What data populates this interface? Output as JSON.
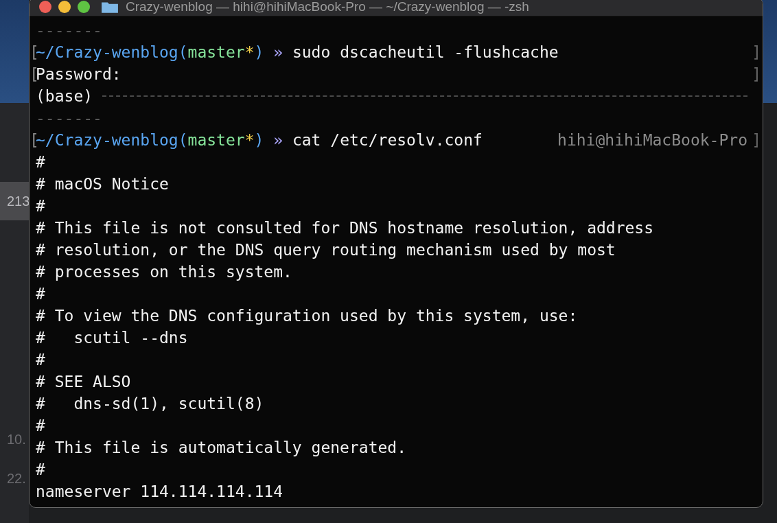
{
  "background": {
    "sizes": [
      {
        "text": "213",
        "selected": true
      },
      {
        "text": "10.",
        "selected": false
      },
      {
        "text": "22.",
        "selected": false
      }
    ]
  },
  "terminal": {
    "title": "Crazy-wenblog — hihi@hihiMacBook-Pro — ~/Crazy-wenblog — -zsh",
    "lines": [
      {
        "kind": "rule_end",
        "text": "-------"
      },
      {
        "kind": "prompt",
        "left_bracket": "[",
        "segments": [
          {
            "text": "~/Crazy-wenblog(",
            "color": "#5aa6f2"
          },
          {
            "text": "master",
            "color": "#86e39a"
          },
          {
            "text": "*",
            "color": "#f3cf4a"
          },
          {
            "text": ")",
            "color": "#5aa6f2"
          },
          {
            "text": " » ",
            "color": "#a9a3f7"
          },
          {
            "text": "sudo dscacheutil -flushcache",
            "color": "#f2f2f2"
          }
        ],
        "right_bracket": "]"
      },
      {
        "kind": "plain",
        "left_bracket": "[",
        "text": "Password:",
        "right_bracket": "]"
      },
      {
        "kind": "base",
        "text": "(base)"
      },
      {
        "kind": "rule_end",
        "text": "-------"
      },
      {
        "kind": "prompt",
        "left_bracket": "[",
        "segments": [
          {
            "text": "~/Crazy-wenblog(",
            "color": "#5aa6f2"
          },
          {
            "text": "master",
            "color": "#86e39a"
          },
          {
            "text": "*",
            "color": "#f3cf4a"
          },
          {
            "text": ")",
            "color": "#5aa6f2"
          },
          {
            "text": " » ",
            "color": "#a9a3f7"
          },
          {
            "text": "cat /etc/resolv.conf",
            "color": "#f2f2f2"
          }
        ],
        "right_text": "hihi@hihiMacBook-Pro",
        "right_bracket": "]"
      },
      {
        "kind": "plain",
        "text": "#"
      },
      {
        "kind": "plain",
        "text": "# macOS Notice"
      },
      {
        "kind": "plain",
        "text": "#"
      },
      {
        "kind": "plain",
        "text": "# This file is not consulted for DNS hostname resolution, address"
      },
      {
        "kind": "plain",
        "text": "# resolution, or the DNS query routing mechanism used by most"
      },
      {
        "kind": "plain",
        "text": "# processes on this system."
      },
      {
        "kind": "plain",
        "text": "#"
      },
      {
        "kind": "plain",
        "text": "# To view the DNS configuration used by this system, use:"
      },
      {
        "kind": "plain",
        "text": "#   scutil --dns"
      },
      {
        "kind": "plain",
        "text": "#"
      },
      {
        "kind": "plain",
        "text": "# SEE ALSO"
      },
      {
        "kind": "plain",
        "text": "#   dns-sd(1), scutil(8)"
      },
      {
        "kind": "plain",
        "text": "#"
      },
      {
        "kind": "plain",
        "text": "# This file is automatically generated."
      },
      {
        "kind": "plain",
        "text": "#"
      },
      {
        "kind": "plain",
        "text": "nameserver 114.114.114.114"
      }
    ]
  }
}
